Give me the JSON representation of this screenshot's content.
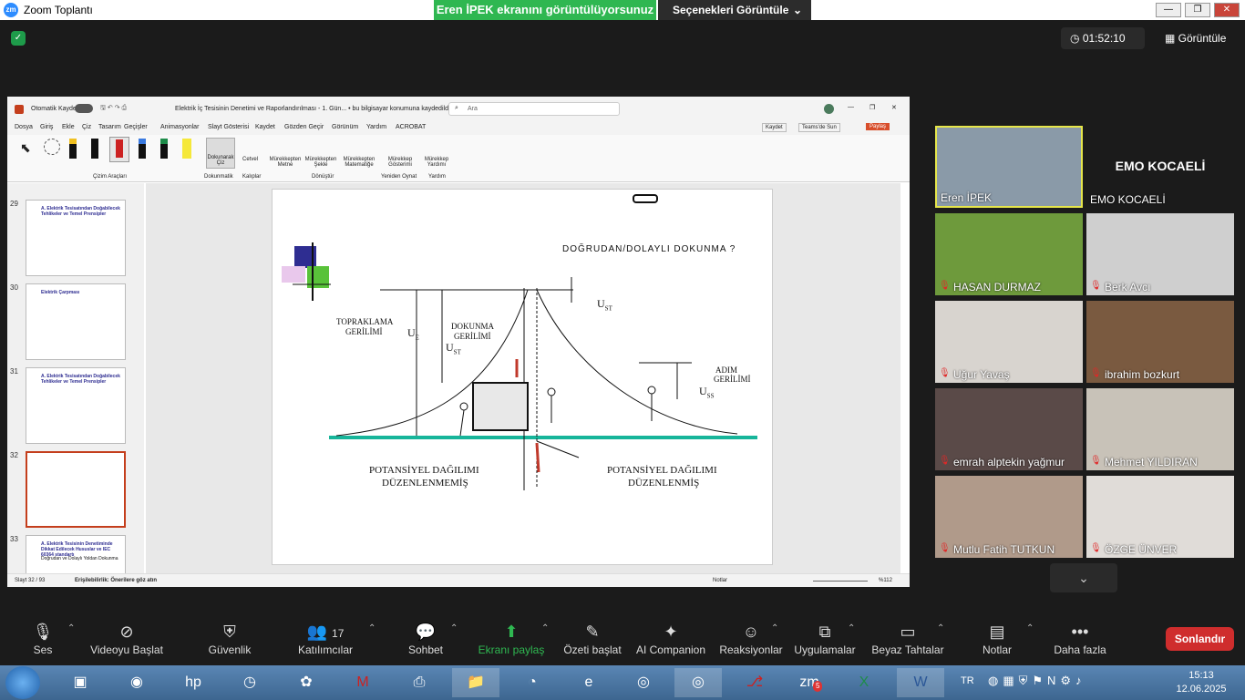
{
  "window": {
    "title": "Zoom Toplantı",
    "share_banner": "Eren İPEK ekranını görüntülüyorsunuz",
    "view_options": "Seçenekleri Görüntüle"
  },
  "top": {
    "timer": "01:52:10",
    "view": "Görüntüle"
  },
  "ppt": {
    "autosave": "Otomatik Kaydet",
    "doc_title": "Elektrik İç Tesisinin Denetimi ve Raporlandırılması - 1. Gün...  •  bu bilgisayar konumuna kaydedildi",
    "search": "Ara",
    "menu": [
      "Dosya",
      "Giriş",
      "Ekle",
      "Çiz",
      "Tasarım",
      "Geçişler",
      "Animasyonlar",
      "Slayt Gösterisi",
      "Kaydet",
      "Gözden Geçir",
      "Görünüm",
      "Yardım",
      "ACROBAT"
    ],
    "save_btn": "Kaydet",
    "teams_btn": "Teams'de Sun",
    "share_btn": "Paylaş",
    "ribbon": {
      "tools_group": "Çizim Araçları",
      "touch": "Dokunarak Çiz",
      "touch_group": "Dokunmatik",
      "ruler": "Cetvel",
      "ruler_group": "Kalıplar",
      "ink_text": "Mürekkepten Metne",
      "ink_shape": "Mürekkepten Şekle",
      "ink_math": "Mürekkepten Matematiğe",
      "convert_group": "Dönüştür",
      "ink_replay": "Mürekkep Gösterimi",
      "replay_group": "Yeniden Oynat",
      "ink_help": "Mürekkep Yardımı",
      "help_group": "Yardım"
    },
    "thumbs": [
      {
        "num": "29",
        "title": "A. Elektrik Tesisatından Doğabilecek Tehlikeler ve Temel Prensipler"
      },
      {
        "num": "30",
        "title": "Elektrik Çarpması"
      },
      {
        "num": "31",
        "title": "A. Elektrik Tesisatından Doğabilecek Tehlikeler ve Temel Prensipler"
      },
      {
        "num": "32",
        "title": ""
      },
      {
        "num": "33",
        "title": "A. Elektrik Tesisinin Denetiminde Dikkat Edilecek Hususlar ve IEC 60364 standartı",
        "sub": "Doğrudan ve Dolaylı Yoldan Dokunma"
      }
    ],
    "slide": {
      "title": "DOĞRUDAN/DOLAYLI DOKUNMA ?",
      "topraklama": "TOPRAKLAMA",
      "topraklama2": "GERİLİMİ",
      "dokunma": "DOKUNMA",
      "dokunma2": "GERİLİMİ",
      "adim": "ADIM",
      "adim2": "GERİLİMİ",
      "ue": "U",
      "ue_sub": "E",
      "ust": "U",
      "ust_sub": "ST",
      "ust2": "U",
      "ust2_sub": "ST",
      "uss": "U",
      "uss_sub": "SS",
      "left1": "POTANSİYEL DAĞILIMI",
      "left2": "DÜZENLENMEMİŞ",
      "right1": "POTANSİYEL DAĞILIMI",
      "right2": "DÜZENLENMİŞ"
    },
    "status": {
      "slide": "Slayt 32 / 93",
      "access": "Erişilebilirlik: Önerilere göz atın",
      "notes": "Notlar",
      "zoom": "%112"
    }
  },
  "participants": [
    {
      "name": "Eren İPEK",
      "muted": false,
      "bg": "#8a9aa8"
    },
    {
      "name": "EMO KOCAELİ",
      "muted": false,
      "bg": "#1b1b1b"
    },
    {
      "name": "HASAN DURMAZ",
      "muted": true,
      "bg": "#6e9a3c"
    },
    {
      "name": "Berk Avcı",
      "muted": true,
      "bg": "#cfcfcf"
    },
    {
      "name": "Uğur Yavaş",
      "muted": true,
      "bg": "#d8d4cf"
    },
    {
      "name": "ibrahim bozkurt",
      "muted": true,
      "bg": "#7a5a40"
    },
    {
      "name": "emrah alptekin yağmur",
      "muted": true,
      "bg": "#5a4a48"
    },
    {
      "name": "Mehmet YILDIRAN",
      "muted": true,
      "bg": "#c8c2b8"
    },
    {
      "name": "Mutlu Fatih TUTKUN",
      "muted": true,
      "bg": "#b09a8a"
    },
    {
      "name": "ÖZGE ÜNVER",
      "muted": true,
      "bg": "#e0dcd8"
    }
  ],
  "emo_label": "EMO KOCAELİ",
  "bar": {
    "audio": "Ses",
    "video": "Videoyu Başlat",
    "security": "Güvenlik",
    "participants": "Katılımcılar",
    "participants_count": "17",
    "chat": "Sohbet",
    "share": "Ekranı paylaş",
    "summary": "Özeti başlat",
    "ai": "AI Companion",
    "reactions": "Reaksiyonlar",
    "apps": "Uygulamalar",
    "whiteboards": "Beyaz Tahtalar",
    "notes": "Notlar",
    "more": "Daha fazla",
    "end": "Sonlandır"
  },
  "taskbar": {
    "lang": "TR",
    "time": "15:13",
    "date": "12.06.2025",
    "zoom_badge": "5"
  }
}
